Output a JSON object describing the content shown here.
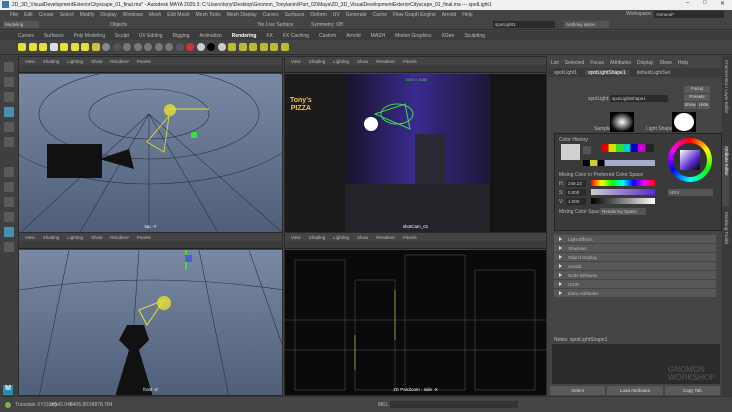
{
  "window": {
    "title": "2D_3D_VisualDevelopmentExteriorCityscape_01_final.ma* - Autodesk MAYA 2025.3: C:\\Users\\tony\\Desktop\\Gnomon_Tonylanini\\Part_02\\Maya\\2D_3D_VisualDevelopmentExteriorCityscape_01_final.ma --- spotLight1",
    "minimize": "–",
    "maximize": "□",
    "close": "✕"
  },
  "menubar": [
    "File",
    "Edit",
    "Create",
    "Select",
    "Modify",
    "Display",
    "Windows",
    "Mesh",
    "Edit Mesh",
    "Mesh Tools",
    "Mesh Display",
    "Curves",
    "Surfaces",
    "Deform",
    "UV",
    "Generate",
    "Cache",
    "Flow Graph Engine",
    "Arnold",
    "Help"
  ],
  "workspace": {
    "label": "Workspace:",
    "value": "General*"
  },
  "status": {
    "mode": "Modeling",
    "objects": "Objects",
    "live_surface": "No Live Surface",
    "symmetry": "Symmetry: Off",
    "selection_field": "spotLight1",
    "user": "Anthony Ianos"
  },
  "shelf_tabs": [
    "Curves",
    "Surfaces",
    "Poly Modeling",
    "Sculpt",
    "UV Editing",
    "Rigging",
    "Animation",
    "Rendering",
    "FX",
    "FX Caching",
    "Custom",
    "Arnold",
    "MASH",
    "Motion Graphics",
    "XGen",
    "Sculpting"
  ],
  "shelf_active": "Rendering",
  "viewport_menu": [
    "View",
    "Shading",
    "Lighting",
    "Show",
    "Renderer",
    "Panels"
  ],
  "viewports": [
    {
      "label": "top -Y"
    },
    {
      "label": "shotCam_01",
      "resolution": "1920 x 1080"
    },
    {
      "label": "front -Z"
    },
    {
      "label": "2D PanZoom - side -X"
    }
  ],
  "sign": {
    "line1": "Tony's",
    "line2": "PIZZA"
  },
  "attribute_editor": {
    "menu": [
      "List",
      "Selected",
      "Focus",
      "Attributes",
      "Display",
      "Show",
      "Help"
    ],
    "tabs": [
      "spotLight1",
      "spotLightShape1",
      "defaultLightSet"
    ],
    "active_tab": "spotLightShape1",
    "field_label": "spotLight:",
    "field_value": "spotLightShape1",
    "buttons": {
      "focus": "Focus",
      "presets": "Presets",
      "show": "Show",
      "hide": "Hide"
    },
    "sample_label": "Sample",
    "light_shape_label": "Light Shape",
    "color": {
      "history_label": "Color History",
      "mixing_label": "Mixing Color in Preferred Color Space",
      "h_label": "H:",
      "h": "249.23",
      "s_label": "S:",
      "s": "0.000",
      "v_label": "V:",
      "v": "1.000",
      "mode": "HSV",
      "mixing_space_label": "Mixing Color Space:",
      "mixing_space": "Rendering Space"
    },
    "sections": [
      "Light Effects",
      "Shadows",
      "Object Display",
      "Arnold",
      "Node Behavior",
      "UUID",
      "Extra Attributes"
    ],
    "notes_label": "Notes: spotLightShape1",
    "bottom_buttons": [
      "Select",
      "Load Attributes",
      "Copy Tab"
    ],
    "watermark": "GNOMON WORKSHOP"
  },
  "side_tabs": [
    "Channel Box / Layer Editor",
    "Attribute Editor",
    "Modeling Toolkit"
  ],
  "helpline": {
    "tool": "Translate XYZ(cm):",
    "x": "16542.048",
    "y": "6406.803",
    "z": "-8878.784",
    "mel": "MEL"
  },
  "colors": {
    "accent": "#4a8fb5",
    "viewport_blue": "#5a6f8f",
    "light_yellow": "#e6e033",
    "light_green": "#3fdc4a"
  }
}
